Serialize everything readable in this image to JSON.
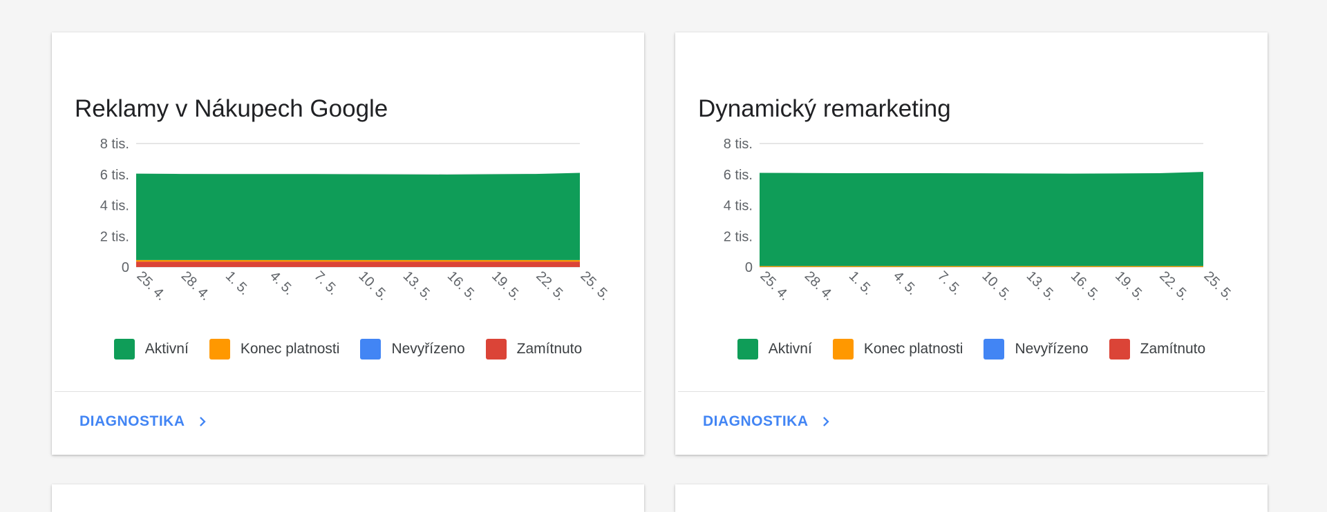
{
  "cards": [
    {
      "title": "Reklamy v Nákupech Google",
      "footer_link": "DIAGNOSTIKA",
      "legend": [
        {
          "label": "Aktivní",
          "color": "#0f9d58"
        },
        {
          "label": "Konec platnosti",
          "color": "#ff9800"
        },
        {
          "label": "Nevyřízeno",
          "color": "#4285f4"
        },
        {
          "label": "Zamítnuto",
          "color": "#db4437"
        }
      ],
      "chart_data": {
        "type": "area",
        "stacked": true,
        "x": [
          "25. 4.",
          "28. 4.",
          "1. 5.",
          "4. 5.",
          "7. 5.",
          "10. 5.",
          "13. 5.",
          "16. 5.",
          "19. 5.",
          "22. 5.",
          "25. 5."
        ],
        "yticks": [
          "0",
          "2 tis.",
          "4 tis.",
          "8 tis.",
          "6 tis."
        ],
        "ytick_values": [
          0,
          2000,
          4000,
          8000,
          6000
        ],
        "ylim": [
          0,
          8000
        ],
        "series": [
          {
            "name": "Zamítnuto",
            "color": "#db4437",
            "values": [
              350,
              350,
              350,
              350,
              350,
              350,
              350,
              350,
              350,
              350,
              350
            ]
          },
          {
            "name": "Nevyřízeno",
            "color": "#4285f4",
            "values": [
              0,
              0,
              0,
              0,
              0,
              0,
              0,
              0,
              0,
              0,
              0
            ]
          },
          {
            "name": "Konec platnosti",
            "color": "#ff9800",
            "values": [
              100,
              100,
              100,
              100,
              100,
              100,
              100,
              100,
              100,
              100,
              100
            ]
          },
          {
            "name": "Aktivní",
            "color": "#0f9d58",
            "values": [
              5600,
              5580,
              5570,
              5570,
              5570,
              5560,
              5550,
              5540,
              5560,
              5580,
              5650
            ]
          }
        ]
      }
    },
    {
      "title": "Dynamický remarketing",
      "footer_link": "DIAGNOSTIKA",
      "legend": [
        {
          "label": "Aktivní",
          "color": "#0f9d58"
        },
        {
          "label": "Konec platnosti",
          "color": "#ff9800"
        },
        {
          "label": "Nevyřízeno",
          "color": "#4285f4"
        },
        {
          "label": "Zamítnuto",
          "color": "#db4437"
        }
      ],
      "chart_data": {
        "type": "area",
        "stacked": true,
        "x": [
          "25. 4.",
          "28. 4.",
          "1. 5.",
          "4. 5.",
          "7. 5.",
          "10. 5.",
          "13. 5.",
          "16. 5.",
          "19. 5.",
          "22. 5.",
          "25. 5."
        ],
        "yticks": [
          "0",
          "2 tis.",
          "4 tis.",
          "8 tis.",
          "6 tis."
        ],
        "ytick_values": [
          0,
          2000,
          4000,
          8000,
          6000
        ],
        "ylim": [
          0,
          8000
        ],
        "series": [
          {
            "name": "Zamítnuto",
            "color": "#db4437",
            "values": [
              0,
              0,
              0,
              0,
              0,
              0,
              0,
              0,
              0,
              0,
              0
            ]
          },
          {
            "name": "Nevyřízeno",
            "color": "#4285f4",
            "values": [
              0,
              0,
              0,
              0,
              0,
              0,
              0,
              0,
              0,
              0,
              0
            ]
          },
          {
            "name": "Konec platnosti",
            "color": "#ff9800",
            "values": [
              60,
              60,
              60,
              60,
              60,
              60,
              60,
              60,
              60,
              60,
              60
            ]
          },
          {
            "name": "Aktivní",
            "color": "#0f9d58",
            "values": [
              6040,
              6030,
              6020,
              6020,
              6020,
              6010,
              6000,
              5990,
              6000,
              6020,
              6100
            ]
          }
        ]
      }
    }
  ]
}
